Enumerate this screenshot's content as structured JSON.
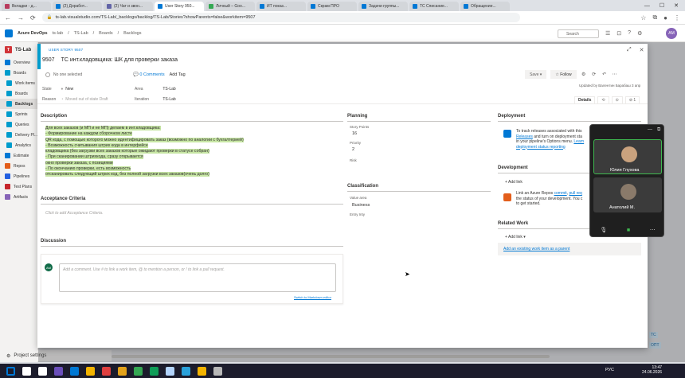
{
  "browser": {
    "tabs": [
      {
        "label": "Вкладки - д...",
        "color": "#b83b5e"
      },
      {
        "label": "(2) Доработ...",
        "color": "#0078d4"
      },
      {
        "label": "(2) Чат и звон...",
        "color": "#6264a7"
      },
      {
        "label": "User Story 950...",
        "color": "#0078d4"
      },
      {
        "label": "Личный – Goo...",
        "color": "#34a853"
      },
      {
        "label": "ИТ показ...",
        "color": "#0078d4"
      },
      {
        "label": "Скрам ПРО",
        "color": "#0078d4"
      },
      {
        "label": "Задачи группы...",
        "color": "#0078d4"
      },
      {
        "label": "ТС Списание...",
        "color": "#0078d4"
      },
      {
        "label": "Обращение...",
        "color": "#0078d4"
      }
    ],
    "url": "ts-lab.visualstudio.com/TS-Lab/_backlogs/backlog/TS-Lab/Stories?showParents=false&workitem=9507"
  },
  "ado": {
    "brand": "Azure DevOps",
    "org": "ts-lab",
    "breadcrumb": [
      "TS-Lab",
      "Boards",
      "Backlogs"
    ],
    "search_placeholder": "Search",
    "avatar": "AM"
  },
  "sidebar": {
    "project": "TS-Lab",
    "project_badge": "T",
    "items": [
      {
        "label": "Overview",
        "color": "#0078d4"
      },
      {
        "label": "Boards",
        "color": "#009ccc"
      },
      {
        "label": "Work items",
        "color": "#009ccc"
      },
      {
        "label": "Boards",
        "color": "#009ccc"
      },
      {
        "label": "Backlogs",
        "color": "#009ccc"
      },
      {
        "label": "Sprints",
        "color": "#009ccc"
      },
      {
        "label": "Queries",
        "color": "#009ccc"
      },
      {
        "label": "Delivery Pl...",
        "color": "#009ccc"
      },
      {
        "label": "Analytics",
        "color": "#009ccc"
      },
      {
        "label": "Estimate",
        "color": "#0078d4"
      },
      {
        "label": "Repos",
        "color": "#e35e1b"
      },
      {
        "label": "Pipelines",
        "color": "#2560e0"
      },
      {
        "label": "Test Plans",
        "color": "#c6252b"
      },
      {
        "label": "Artifacts",
        "color": "#8764b8"
      }
    ],
    "project_settings": "Project settings"
  },
  "workitem": {
    "type_label": "USER STORY 9507",
    "id": "9507",
    "title": "ТС инт.кладовщика: ШК для проверки заказа",
    "assigned": "No one selected",
    "comments": "0 Comments",
    "add_tag": "Add Tag",
    "save": "Save",
    "follow": "Follow",
    "updated": "Updated by Валентин Барабаш 3 апр",
    "state_label": "State",
    "state_value": "New",
    "reason_label": "Reason",
    "reason_value": "Moved out of state Draft",
    "area_label": "Area",
    "area_value": "TS-Lab",
    "iteration_label": "Iteration",
    "iteration_value": "TS-Lab",
    "view_tabs": [
      "Details",
      "⟲",
      "⊙",
      "⊘ 1"
    ],
    "description_header": "Description",
    "description_lines": [
      "Для всех заказов (и МП и не МП) делаем в инт.кладовщика:",
      " - Формирование на каждом сборочном листе",
      "QR кода, с помощью которого можно идентифицировать заказ (возможно по аналогии с бухгалтерией)",
      " - Возможность считывания штрих кода в интерфейсе",
      "кладовщика (без загрузки всех заказов которые ожидают проверки в статусе собран)",
      " - При сканировании штрихкода, сразу открывается",
      "окно проверки заказа, с позициями",
      " - По окончанию проверки, есть возможность",
      "отсканировать следующий штрих код, без полной загрузки всех заказов(очень долго)"
    ],
    "acceptance_header": "Acceptance Criteria",
    "acceptance_placeholder": "Click to add Acceptance Criteria.",
    "discussion_header": "Discussion",
    "discussion_avatar": "AM",
    "discussion_placeholder": "Add a comment. Use # to link a work item, @ to mention a person, or ! to link a pull request.",
    "markdown_link": "Switch to Markdown editor",
    "planning_header": "Planning",
    "story_points_label": "Story Points",
    "story_points_value": "16",
    "priority_label": "Priority",
    "priority_value": "2",
    "risk_label": "Risk",
    "classification_header": "Classification",
    "value_area_label": "Value area",
    "value_area_value": "Business",
    "entry_lbl": "Entry Inty",
    "deployment_header": "Deployment",
    "deployment_text_1": "To track releases associated with this",
    "deployment_link_1": "Releases",
    "deployment_text_2": "and turn on deployment sta",
    "deployment_text_3": "in your pipeline's Options menu.",
    "deployment_link_2": "Learn",
    "deployment_link_3": "deployment status reporting",
    "development_header": "Development",
    "add_link": "Add link",
    "development_text_1": "Link an Azure Repos",
    "development_link_1": "commit",
    "development_link_2": "pull req",
    "development_text_2": "the status of your development. You c",
    "development_text_3": "to get started.",
    "related_header": "Related Work",
    "related_add_link": "Add link",
    "related_parent_link": "Add an existing work item as a parent"
  },
  "video_call": {
    "participants": [
      {
        "name": "Юлия Глухова",
        "speaking": true,
        "face": "#c9a27e"
      },
      {
        "name": "Анатолий М.",
        "speaking": false,
        "face": "#8a7a6a"
      }
    ]
  },
  "taskbar": {
    "lang": "РУС",
    "time": "13:47",
    "date": "24.06.2026",
    "icons": [
      "#0078d4",
      "#ffffff",
      "#ffffff",
      "#6b4fbb",
      "#0078d4",
      "#f4b400",
      "#e04040",
      "#e3a21a",
      "#34a853",
      "#0f9d58",
      "#b3d4fc",
      "#2aa1da",
      "#f4b400",
      "#b8b8b8"
    ]
  },
  "right_tags": [
    "ТС",
    "ОПТ"
  ]
}
